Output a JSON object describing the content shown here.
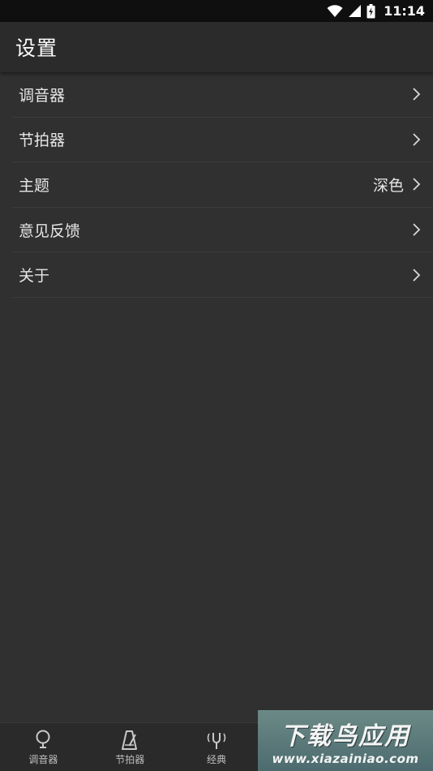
{
  "status_bar": {
    "time": "11:14",
    "icons": [
      "wifi-icon",
      "cell-signal-icon",
      "battery-icon"
    ]
  },
  "app_bar": {
    "title": "设置"
  },
  "settings": {
    "items": [
      {
        "label": "调音器",
        "value": ""
      },
      {
        "label": "节拍器",
        "value": ""
      },
      {
        "label": "主题",
        "value": "深色"
      },
      {
        "label": "意见反馈",
        "value": ""
      },
      {
        "label": "关于",
        "value": ""
      }
    ]
  },
  "bottom_nav": {
    "items": [
      {
        "label": "调音器",
        "icon": "tuner-icon"
      },
      {
        "label": "节拍器",
        "icon": "metronome-icon"
      },
      {
        "label": "经典",
        "icon": "tuning-fork-icon"
      },
      {
        "label": "",
        "icon": "hidden-item"
      },
      {
        "label": "",
        "icon": "hidden-item"
      }
    ]
  },
  "watermark": {
    "main": "下载鸟应用",
    "sub": "www.xiazainiao.com"
  },
  "colors": {
    "background": "#303030",
    "app_bar": "#2b2b2b",
    "status_bar": "#0f0f0f",
    "text": "#e6e6e6",
    "divider": "#3b3b3b"
  }
}
